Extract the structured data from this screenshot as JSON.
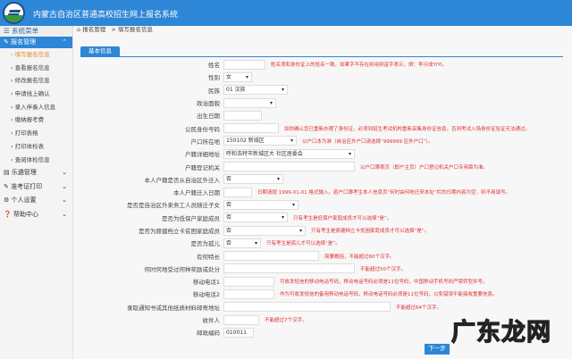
{
  "header": {
    "title": "内蒙古自治区普通高校招生网上报名系统"
  },
  "sidebar": {
    "title": "系统菜单",
    "groups": [
      {
        "label": "报名管理",
        "active": true,
        "items": [
          "填写报名信息",
          "查看报名信息",
          "修改报名信息",
          "申请线上确认",
          "录入伴奏人信息",
          "缴纳报考费",
          "打印表格",
          "打印体检表",
          "查阅体检信息"
        ]
      },
      {
        "label": "乐遴管理"
      },
      {
        "label": "准考证打印"
      },
      {
        "label": "个人设置"
      },
      {
        "label": "帮助中心"
      }
    ]
  },
  "breadcrumb": {
    "home": "报名管理",
    "current": "> 填写报名信息"
  },
  "tab": "基本信息",
  "form": [
    {
      "label": "姓名",
      "type": "input",
      "value": "",
      "hint": "姓名须和身份证上的姓名一致。如果字不存在则用拼音字表示，例：李示成YIYI。"
    },
    {
      "label": "性别",
      "type": "select",
      "value": "女",
      "hint": ""
    },
    {
      "label": "民族",
      "type": "select",
      "value": "01 汉族",
      "hint": ""
    },
    {
      "label": "政治面貌",
      "type": "select",
      "value": "",
      "hint": ""
    },
    {
      "label": "出生日期",
      "type": "input",
      "value": "",
      "hint": ""
    },
    {
      "label": "公民身份号码",
      "type": "input",
      "value": "",
      "hint": "如你确认您已重新办理了身份证，必须到招生考试机构重新采集身份证信息，否则考试入场身份证验证无法通过。"
    },
    {
      "label": "户口所在地",
      "type": "select",
      "value": "150102 新城区",
      "hint": "以户口本为准（自治区外户口请选择“999999 区外户口”）。"
    },
    {
      "label": "户籍详细地址",
      "type": "select",
      "value": "呼和浩特市新城区大                          社区居委会",
      "hint": ""
    },
    {
      "label": "户籍登记机关",
      "type": "input",
      "value": "",
      "hint": "以户口簿首页（即户主页）户口登记机关户口专用章为准。"
    },
    {
      "label": "本人户籍是否从自治区外迁入",
      "type": "select",
      "value": "否",
      "hint": ""
    },
    {
      "label": "本人户籍迁入日期",
      "type": "input",
      "value": "",
      "hint": "日期请按 1999-01-01 格式输入。若户口簿考生本人信息页“何时由何地迁来本址”栏的日期内容为空，则不用填写。"
    },
    {
      "label": "是否是自治区外来务工人员随迁子女",
      "type": "select",
      "value": "否",
      "hint": ""
    },
    {
      "label": "是否为低保户家庭成员",
      "type": "select",
      "value": "否",
      "hint": "只有考生是低保户家庭成员才可以选择“是”。"
    },
    {
      "label": "是否为原建档立卡贫困家庭成员",
      "type": "select",
      "value": "否",
      "hint": "只有考生是原建档立卡贫困家庭成员才可以选择“是”。"
    },
    {
      "label": "是否为孤儿",
      "type": "select",
      "value": "否",
      "hint": "只有考生是孤儿才可以选择“是”。"
    },
    {
      "label": "有何特长",
      "type": "input",
      "value": "",
      "hint": "简要概括，不能超过60个汉字。"
    },
    {
      "label": "何时何地受过何种奖励或处分",
      "type": "input",
      "value": "",
      "hint": "不能超过50个汉字。"
    },
    {
      "label": "移动电话1",
      "type": "input",
      "value": "",
      "hint": "可收发短信的移动电话号码，移动电话号码必须是11位号码，中国移动手机号码严禁转型并号。"
    },
    {
      "label": "移动电话2",
      "type": "input",
      "value": "",
      "hint": "作为可收发短信的备用移动电话号码，移动电话号码必须是11位号码，以免错误不能接收重要信息。"
    },
    {
      "label": "录取通知书或其他纸质材料邮寄地址",
      "type": "input",
      "value": "",
      "hint": "不能超过64个汉字。"
    },
    {
      "label": "收件人",
      "type": "input",
      "value": "",
      "hint": "不能超过7个汉字。"
    },
    {
      "label": "邮政编码",
      "type": "input",
      "value": "010011",
      "hint": ""
    }
  ],
  "next_button": "下一步",
  "watermark": "广东龙网",
  "colors": {
    "primary": "#2d86d6",
    "hint": "#e02f2f",
    "current": "#e8892a"
  }
}
